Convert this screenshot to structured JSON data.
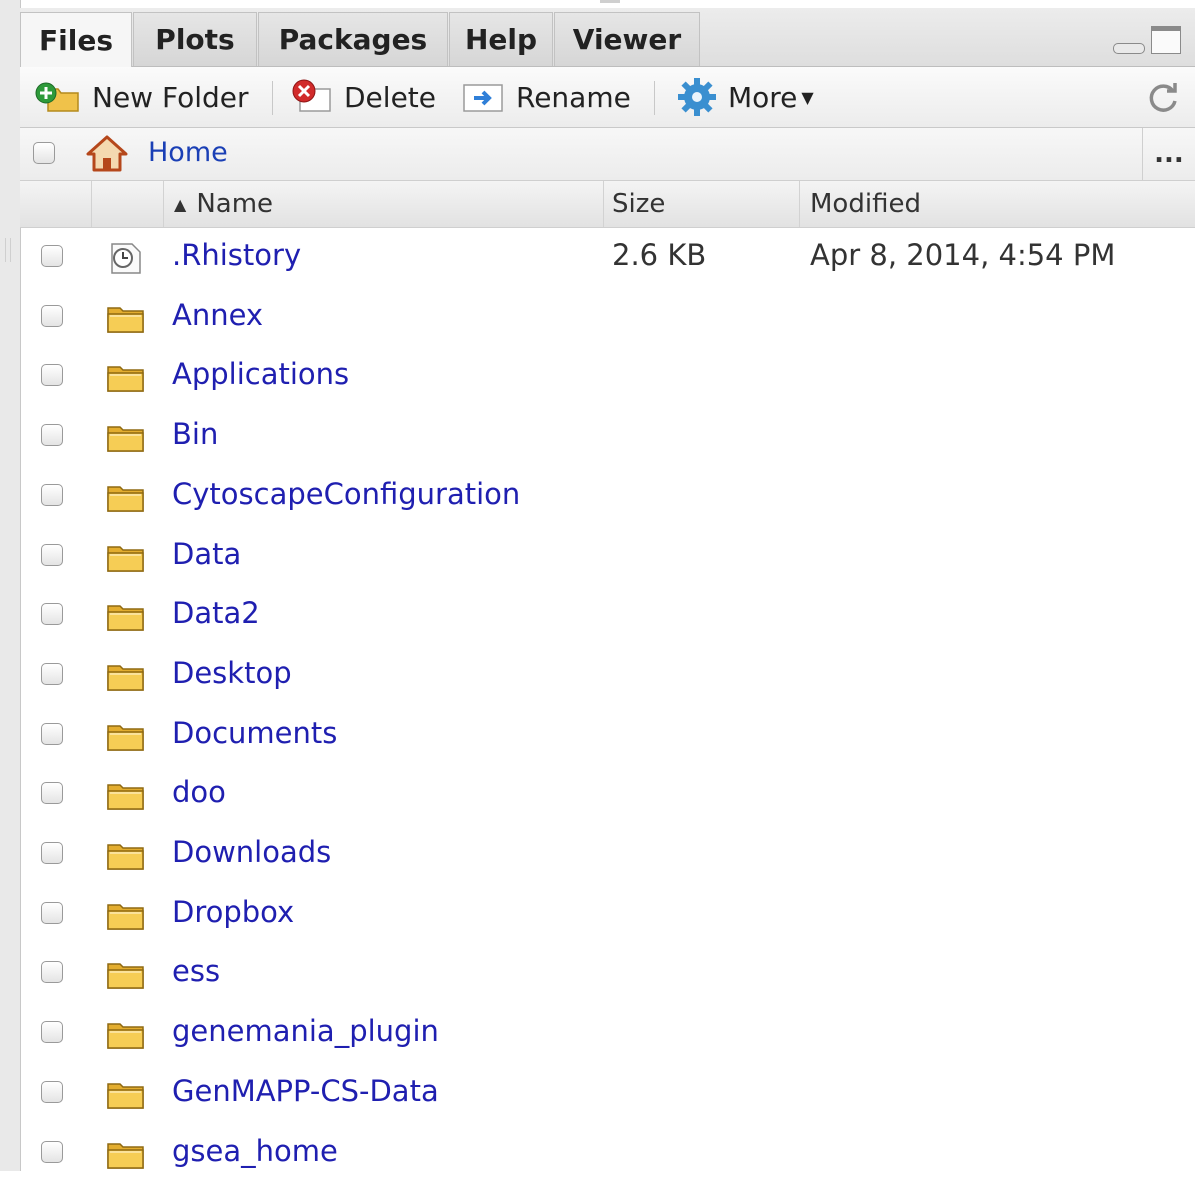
{
  "tabs": [
    {
      "label": "Files",
      "active": true
    },
    {
      "label": "Plots",
      "active": false
    },
    {
      "label": "Packages",
      "active": false
    },
    {
      "label": "Help",
      "active": false
    },
    {
      "label": "Viewer",
      "active": false
    }
  ],
  "toolbar": {
    "new_folder_label": "New Folder",
    "delete_label": "Delete",
    "rename_label": "Rename",
    "more_label": "More"
  },
  "breadcrumb": {
    "home_label": "Home",
    "more_label": "..."
  },
  "columns": {
    "name": "Name",
    "size": "Size",
    "modified": "Modified",
    "sort_indicator": "▲"
  },
  "files": [
    {
      "name": ".Rhistory",
      "type": "file",
      "size": "2.6 KB",
      "modified": "Apr 8, 2014, 4:54 PM"
    },
    {
      "name": "Annex",
      "type": "folder",
      "size": "",
      "modified": ""
    },
    {
      "name": "Applications",
      "type": "folder",
      "size": "",
      "modified": ""
    },
    {
      "name": "Bin",
      "type": "folder",
      "size": "",
      "modified": ""
    },
    {
      "name": "CytoscapeConfiguration",
      "type": "folder",
      "size": "",
      "modified": ""
    },
    {
      "name": "Data",
      "type": "folder",
      "size": "",
      "modified": ""
    },
    {
      "name": "Data2",
      "type": "folder",
      "size": "",
      "modified": ""
    },
    {
      "name": "Desktop",
      "type": "folder",
      "size": "",
      "modified": ""
    },
    {
      "name": "Documents",
      "type": "folder",
      "size": "",
      "modified": ""
    },
    {
      "name": "doo",
      "type": "folder",
      "size": "",
      "modified": ""
    },
    {
      "name": "Downloads",
      "type": "folder",
      "size": "",
      "modified": ""
    },
    {
      "name": "Dropbox",
      "type": "folder",
      "size": "",
      "modified": ""
    },
    {
      "name": "ess",
      "type": "folder",
      "size": "",
      "modified": ""
    },
    {
      "name": "genemania_plugin",
      "type": "folder",
      "size": "",
      "modified": ""
    },
    {
      "name": "GenMAPP-CS-Data",
      "type": "folder",
      "size": "",
      "modified": ""
    },
    {
      "name": "gsea_home",
      "type": "folder",
      "size": "",
      "modified": ""
    }
  ],
  "colors": {
    "link": "#1f1fb0",
    "folder": "#f0c24a",
    "delete_red": "#d12b2b",
    "new_folder_green": "#2e9a3a",
    "gear_blue": "#3a8fd0"
  }
}
